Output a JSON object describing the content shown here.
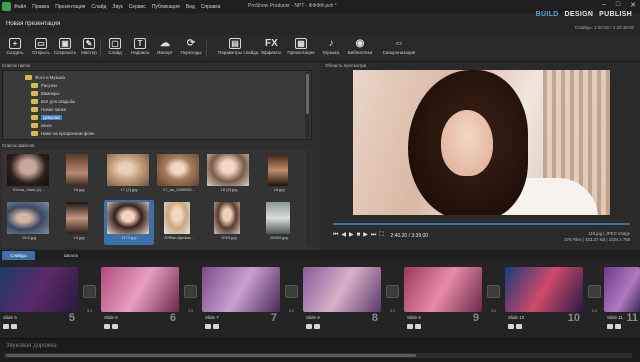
{
  "titlebar": {
    "menu": [
      "Файл",
      "Правка",
      "Презентация",
      "Слайд",
      "Звук",
      "Сервис",
      "Публикация",
      "Вид",
      "Справка"
    ],
    "window_title": "ProShow Producer - NPT - ФФФФ.psh *",
    "mode_tabs": [
      "BUILD",
      "DESIGN",
      "PUBLISH"
    ],
    "active_mode": "BUILD",
    "controls": [
      "–",
      "□",
      "✕"
    ]
  },
  "project": {
    "title": "Новая презентация",
    "meta": "Слайды: 1:00:00 / 1:20:38:00"
  },
  "toolbar": {
    "items": [
      {
        "label": "Создать",
        "icon": "new-icon",
        "glyph": "+"
      },
      {
        "label": "Открыть",
        "icon": "open-folder-icon",
        "glyph": "▭"
      },
      {
        "label": "Сохранить",
        "icon": "save-icon",
        "glyph": "▣"
      },
      {
        "label": "Мастер",
        "icon": "wizard-icon",
        "glyph": "✎"
      },
      {
        "label": "Слайд",
        "icon": "slide-icon",
        "glyph": "▢"
      },
      {
        "label": "Надписи",
        "icon": "captions-icon",
        "glyph": "T"
      },
      {
        "label": "Импорт",
        "icon": "import-icon",
        "glyph": "☁"
      },
      {
        "label": "Переходы",
        "icon": "transitions-icon",
        "glyph": "⟳"
      },
      {
        "label": "Параметры слайда",
        "icon": "slide-options-icon",
        "glyph": "▤"
      },
      {
        "label": "Эффекты",
        "icon": "effects-icon",
        "glyph": "FX"
      },
      {
        "label": "Презентация",
        "icon": "presentation-icon",
        "glyph": "▦"
      },
      {
        "label": "Музыка",
        "icon": "music-icon",
        "glyph": "♪"
      },
      {
        "label": "Библиотека",
        "icon": "library-icon",
        "glyph": "◉"
      },
      {
        "label": "Синхронизация",
        "icon": "sync-icon",
        "glyph": "⇔"
      }
    ]
  },
  "tree": {
    "header": "Список папок",
    "rows": [
      {
        "label": "Фото и Музыка",
        "selected": false
      },
      {
        "label": "Рисунок",
        "selected": false
      },
      {
        "label": "Вампиры",
        "selected": false
      },
      {
        "label": "Всё для свадьбы",
        "selected": false
      },
      {
        "label": "Новая папка",
        "selected": false
      },
      {
        "label": "девушки",
        "selected": true
      },
      {
        "label": "книги",
        "selected": false
      },
      {
        "label": "Ниже на прозрачном фоне",
        "selected": false
      }
    ]
  },
  "files": {
    "header": "Список файлов",
    "items": [
      {
        "name": "Юлия_Чаев (1)...",
        "selected": false
      },
      {
        "name": "16.jpg",
        "selected": false
      },
      {
        "name": "17 (2).jpg",
        "selected": false
      },
      {
        "name": "17_аа_0380050...",
        "selected": false
      },
      {
        "name": "18 (2).jpg",
        "selected": false
      },
      {
        "name": "18.jpg",
        "selected": false
      },
      {
        "name": "19.6.jpg",
        "selected": false
      },
      {
        "name": "19.jpg",
        "selected": false
      },
      {
        "name": "1173.jpg",
        "selected": true
      },
      {
        "name": "20f9ab.Ajedaw...",
        "selected": false
      },
      {
        "name": "2003.jpg",
        "selected": false
      },
      {
        "name": "90099.jpg",
        "selected": false
      }
    ]
  },
  "preview": {
    "header": "Область просмотра",
    "time": "2:40.20 / 3:39.00",
    "file_name": "119.jpg",
    "file_type": "JPEG Image",
    "file_size": "376 Files",
    "file_kb": "153.37 KB",
    "file_dims": "1024 x 768",
    "progress": 1.0
  },
  "timeline": {
    "tabs": [
      "Слайды",
      "Шкала"
    ],
    "active_tab": "Слайды",
    "slides": [
      {
        "label": "Slide 5",
        "number": "5"
      },
      {
        "label": "Slide 6",
        "number": "6"
      },
      {
        "label": "Slide 7",
        "number": "7"
      },
      {
        "label": "Slide 8",
        "number": "8"
      },
      {
        "label": "Slide 9",
        "number": "9"
      },
      {
        "label": "Slide 10",
        "number": "10"
      },
      {
        "label": "Slide 11",
        "number": "11"
      }
    ],
    "transition_durations": [
      "3.0",
      "3.0",
      "3.0",
      "3.0",
      "3.0",
      "3.0"
    ]
  },
  "audio": {
    "label": "Звуковая дорожка"
  },
  "colors": {
    "accent": "#3d7fc4",
    "folder": "#d8b650"
  }
}
